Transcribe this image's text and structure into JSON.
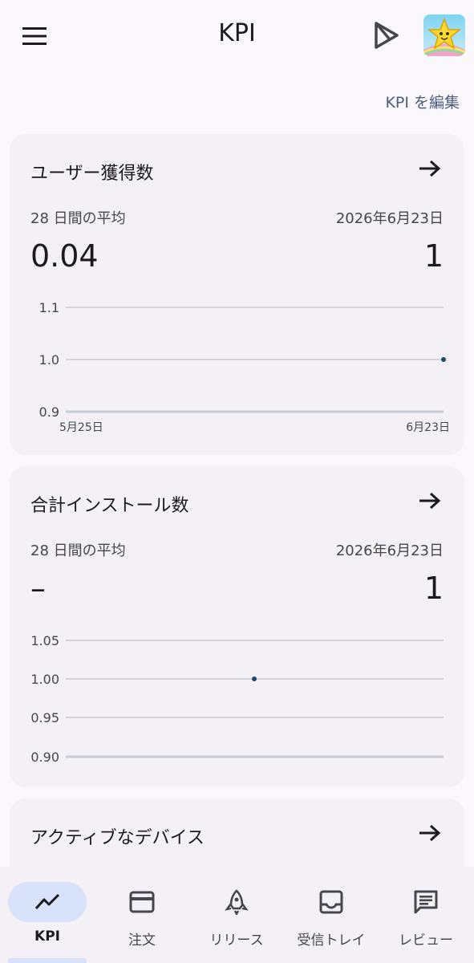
{
  "appbar": {
    "title": "KPI",
    "menu_icon": "menu-icon",
    "play_icon": "play-console-icon",
    "avatar_icon": "app-star-avatar"
  },
  "edit_link": "KPI を編集",
  "cards": [
    {
      "title": "ユーザー獲得数",
      "period_label": "28 日間の平均",
      "date_label": "2026年6月23日",
      "average_value": "0.04",
      "latest_value": "1",
      "chart_data": {
        "type": "line",
        "y_ticks": [
          "1.1",
          "1.0",
          "0.9"
        ],
        "ylim": [
          0.9,
          1.1
        ],
        "x_labels": [
          "5月25日",
          "6月23日"
        ],
        "series": [
          {
            "points": [
              {
                "x": "6月23日",
                "y": 1.0
              }
            ]
          }
        ]
      }
    },
    {
      "title": "合計インストール数",
      "period_label": "28 日間の平均",
      "date_label": "2026年6月23日",
      "average_value": "–",
      "latest_value": "1",
      "chart_data": {
        "type": "line",
        "y_ticks": [
          "1.05",
          "1.00",
          "0.95",
          "0.90"
        ],
        "ylim": [
          0.9,
          1.05
        ],
        "series": [
          {
            "points": [
              {
                "x": "middle",
                "y": 1.0
              }
            ]
          }
        ]
      }
    },
    {
      "title": "アクティブなデバイス"
    }
  ],
  "bottom_nav": [
    {
      "label": "KPI",
      "icon": "trending-icon",
      "active": true
    },
    {
      "label": "注文",
      "icon": "credit-card-icon",
      "active": false
    },
    {
      "label": "リリース",
      "icon": "rocket-icon",
      "active": false
    },
    {
      "label": "受信トレイ",
      "icon": "inbox-icon",
      "active": false
    },
    {
      "label": "レビュー",
      "icon": "review-icon",
      "active": false
    }
  ],
  "colors": {
    "background": "#fbf8fd",
    "card": "#f3f0f6",
    "accent": "#4b5d7e",
    "active_pill": "#d8e2fa",
    "data_point": "#1c4a6b",
    "grid": "#c8ccd6"
  }
}
